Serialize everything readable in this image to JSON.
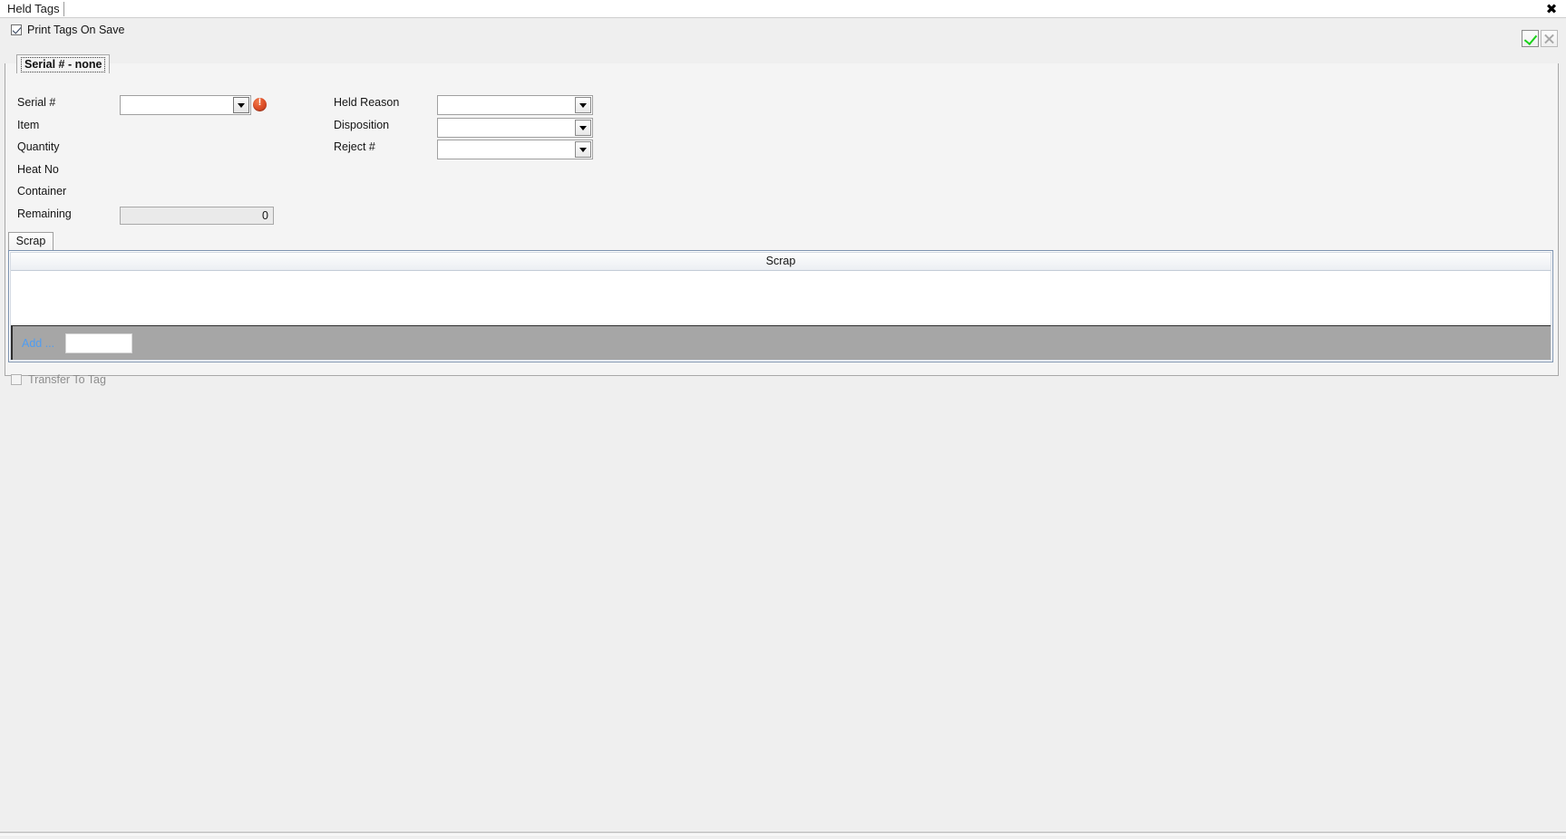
{
  "window": {
    "tab_title": "Held Tags",
    "close_icon": "close-icon"
  },
  "toolbar": {
    "print_tags_label": "Print Tags On Save",
    "print_tags_checked": true,
    "ok_label": "",
    "cancel_label": "",
    "ok_icon": "check-icon",
    "cancel_icon": "x-icon"
  },
  "group_tab": {
    "label": "Serial # - none"
  },
  "form": {
    "left_fields": [
      {
        "label": "Serial #",
        "value": "",
        "control": "combobox",
        "has_error": true
      },
      {
        "label": "Item",
        "value": "",
        "control": "text"
      },
      {
        "label": "Quantity",
        "value": "",
        "control": "text"
      },
      {
        "label": "Heat No",
        "value": "",
        "control": "text"
      },
      {
        "label": "Container",
        "value": "",
        "control": "text"
      },
      {
        "label": "Remaining",
        "value": "0",
        "control": "readonly"
      }
    ],
    "right_fields": [
      {
        "label": "Held Reason",
        "value": "",
        "control": "combobox"
      },
      {
        "label": "Disposition",
        "value": "",
        "control": "combobox"
      },
      {
        "label": "Reject #",
        "value": "",
        "control": "combobox"
      }
    ],
    "error_icon": "error-icon"
  },
  "scrap_section": {
    "tab_label": "Scrap",
    "grid": {
      "columns": [
        "Scrap"
      ],
      "rows": [],
      "add_label": "Add ...",
      "add_cell_value": ""
    }
  },
  "footer": {
    "transfer_label": "Transfer To Tag",
    "transfer_checked": false,
    "transfer_disabled": true
  },
  "colors": {
    "accent_blue": "#4f9df2",
    "error_orange": "#e0522a",
    "ok_green": "#19d219",
    "background": "#efefef"
  }
}
